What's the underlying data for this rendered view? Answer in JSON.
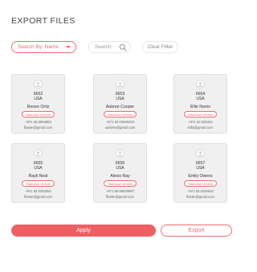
{
  "header": {
    "title": "EXPORT FILES"
  },
  "filters": {
    "search_by_label": "Search By: Name",
    "search_placeholder": "Search",
    "clear_filter_label": "Clear Filter"
  },
  "cards": [
    {
      "id": "6652",
      "country": "USA",
      "name": "Renee Ortiz",
      "badge": "Staircase Vehicle",
      "phone": "+971 55 8903883",
      "email": "ffaster@gmail.com"
    },
    {
      "id": "6653",
      "country": "USA",
      "name": "Aubree Cooper",
      "badge": "Staircase Vehicle",
      "phone": "+971 53 03480453",
      "email": "aubrele@gmail.com"
    },
    {
      "id": "6654",
      "country": "USA",
      "name": "Ellie Norris",
      "badge": "Staircase Vehicle",
      "phone": "+971 53 035342",
      "email": "Ellis@gmail.com"
    },
    {
      "id": "6655",
      "country": "USA",
      "name": "Rayli Neal",
      "badge": "Staircase Vehicle",
      "phone": "+971 53 0353352",
      "email": "ffaster@gmail.com"
    },
    {
      "id": "6656",
      "country": "USA",
      "name": "Alexis Ray",
      "badge": "Staircase Vehicle",
      "phone": "+971 56 86049987",
      "email": "ffaster@gmail.com"
    },
    {
      "id": "6657",
      "country": "USA",
      "name": "Emily Owens",
      "badge": "Staircase Vehicle",
      "phone": "+971 53 0345043",
      "email": "ffaster@gmail.com"
    }
  ],
  "actions": {
    "apply_label": "Apply",
    "export_label": "Export"
  },
  "colors": {
    "accent": "#ee6b6f",
    "apply_bg": "#ee5f64",
    "card_bg": "#f0f0f0"
  },
  "icons": {
    "search": "search-icon",
    "dropdown": "chevron-down-icon",
    "avatar": "user-icon"
  }
}
